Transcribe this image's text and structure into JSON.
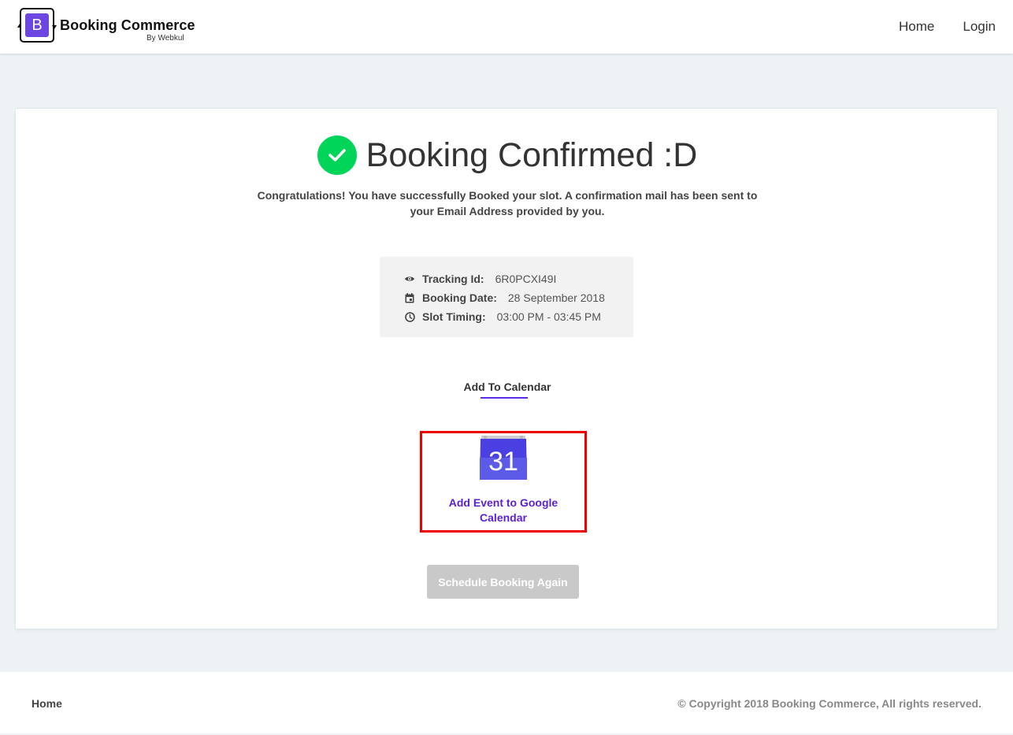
{
  "header": {
    "logo_letter": "B",
    "brand_name": "Booking Commerce",
    "brand_sub": "By Webkul",
    "nav": [
      {
        "label": "Home"
      },
      {
        "label": "Login"
      }
    ]
  },
  "confirmation": {
    "title": "Booking Confirmed :D",
    "message": "Congratulations! You have successfully Booked your slot. A confirmation mail has been sent to your Email Address provided by you.",
    "details": {
      "tracking_label": "Tracking Id:",
      "tracking_value": "6R0PCXI49I",
      "date_label": "Booking Date:",
      "date_value": "28 September 2018",
      "slot_label": "Slot Timing:",
      "slot_value": "03:00 PM - 03:45 PM"
    },
    "calendar_heading": "Add To Calendar",
    "google_calendar_day": "31",
    "google_calendar_link": "Add Event to Google Calendar",
    "schedule_again": "Schedule Booking Again"
  },
  "footer": {
    "home": "Home",
    "copyright": "© Copyright 2018 Booking Commerce, All rights reserved."
  },
  "colors": {
    "accent": "#5b1fd6",
    "success": "#00d55a",
    "highlight_border": "#ee0000",
    "page_bg": "#edf3f5"
  },
  "icons": [
    "check-icon",
    "eye-icon",
    "calendar-icon",
    "clock-icon",
    "google-calendar-icon"
  ]
}
